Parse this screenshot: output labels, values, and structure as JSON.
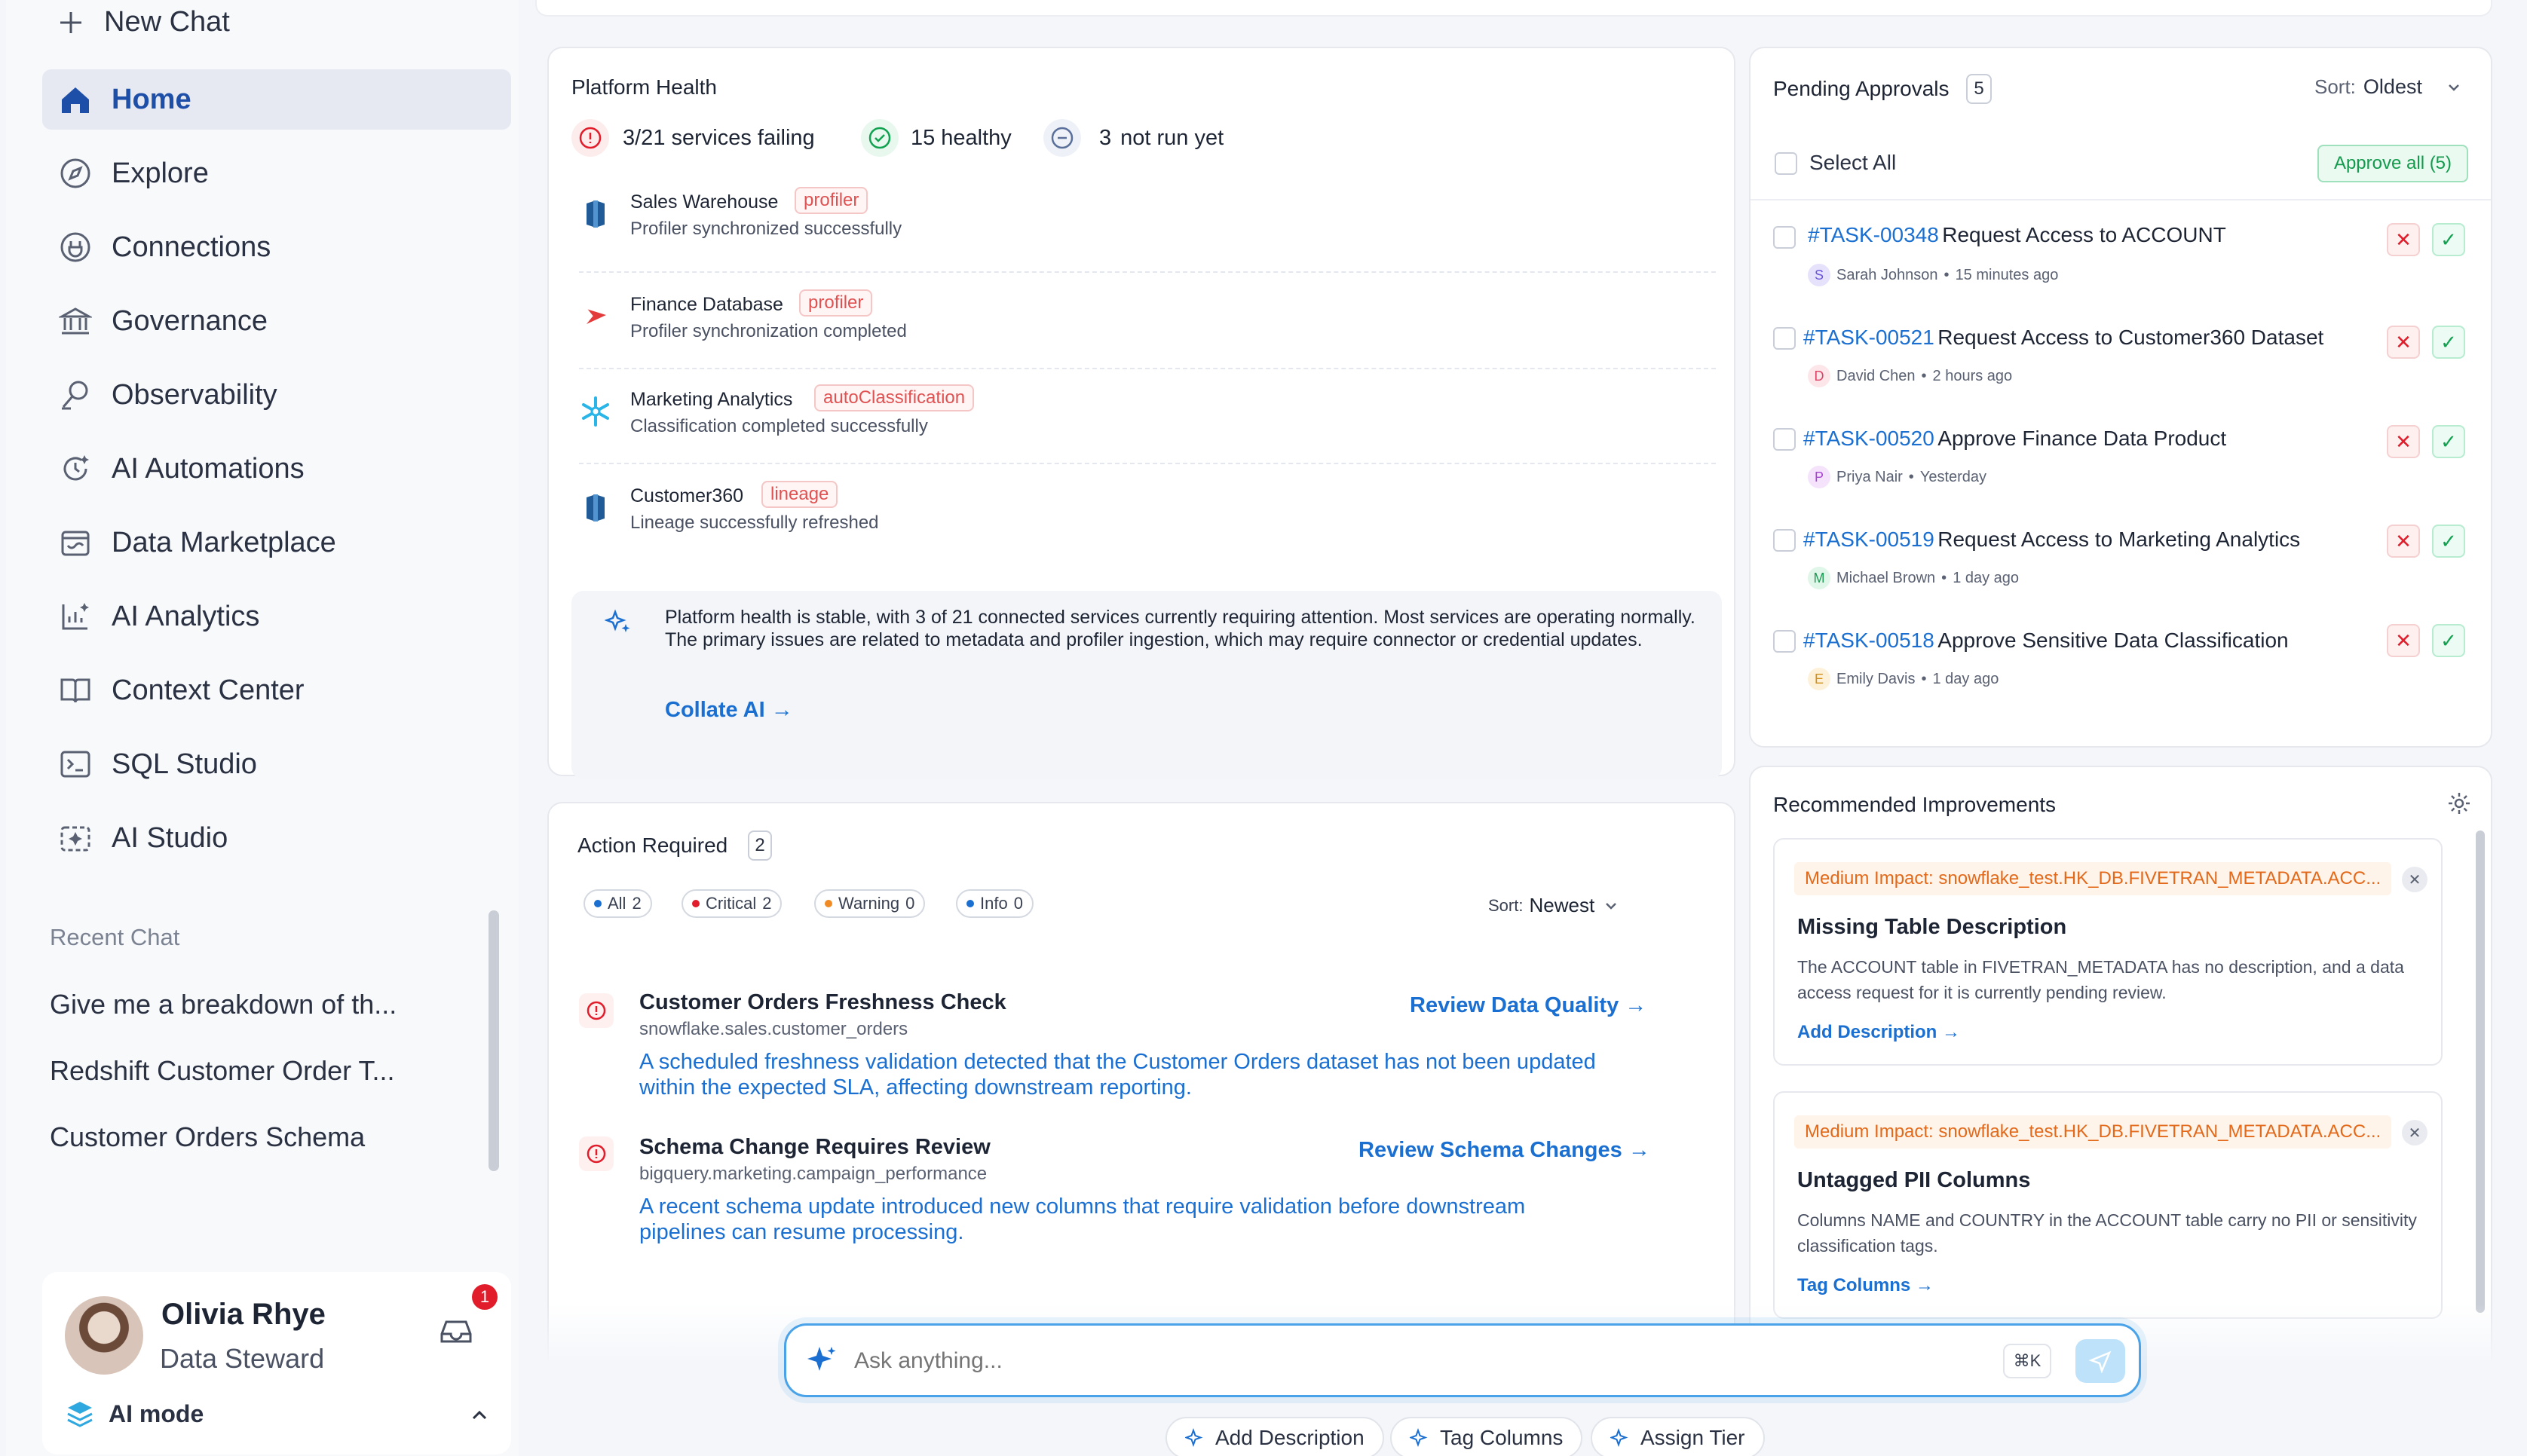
{
  "sidebar": {
    "new_chat": "New Chat",
    "items": [
      {
        "label": "Home",
        "icon": "home-icon"
      },
      {
        "label": "Explore",
        "icon": "compass-icon"
      },
      {
        "label": "Connections",
        "icon": "plug-icon"
      },
      {
        "label": "Governance",
        "icon": "bank-icon"
      },
      {
        "label": "Observability",
        "icon": "telescope-icon"
      },
      {
        "label": "AI Automations",
        "icon": "automation-icon"
      },
      {
        "label": "Data Marketplace",
        "icon": "store-icon"
      },
      {
        "label": "AI Analytics",
        "icon": "analytics-icon"
      },
      {
        "label": "Context Center",
        "icon": "book-icon"
      },
      {
        "label": "SQL Studio",
        "icon": "terminal-icon"
      },
      {
        "label": "AI Studio",
        "icon": "sparkle-box-icon"
      }
    ],
    "recent_title": "Recent Chat",
    "recent": [
      "Give me a breakdown of th...",
      "Redshift Customer Order T...",
      "Customer Orders Schema"
    ],
    "user": {
      "name": "Olivia Rhye",
      "role": "Data Steward",
      "notifications": "1",
      "mode": "AI mode"
    }
  },
  "health": {
    "title": "Platform Health",
    "failing": "3/21 services failing",
    "healthy_count": "15",
    "healthy_label": "healthy",
    "notrun_count": "3",
    "notrun_label": "not run yet",
    "services": [
      {
        "name": "Sales Warehouse",
        "tag": "profiler",
        "desc": "Profiler synchronized successfully",
        "icon": "redshift-icon"
      },
      {
        "name": "Finance Database",
        "tag": "profiler",
        "desc": "Profiler synchronization completed",
        "icon": "database-icon"
      },
      {
        "name": "Marketing Analytics",
        "tag": "autoClassification",
        "desc": "Classification completed successfully",
        "icon": "snowflake-icon"
      },
      {
        "name": "Customer360",
        "tag": "lineage",
        "desc": "Lineage successfully refreshed",
        "icon": "redshift-icon"
      }
    ],
    "summary": "Platform health is stable, with 3 of 21 connected services currently requiring attention. Most services are operating normally. The primary issues are related to metadata and profiler ingestion, which may require connector or credential updates.",
    "collate_link": "Collate AI →"
  },
  "actions": {
    "title": "Action Required",
    "count": "2",
    "filters": [
      {
        "label": "All",
        "count": "2",
        "color": "#1a6fd1"
      },
      {
        "label": "Critical",
        "count": "2",
        "color": "#e11d2b"
      },
      {
        "label": "Warning",
        "count": "0",
        "color": "#f08a24"
      },
      {
        "label": "Info",
        "count": "0",
        "color": "#1a6fd1"
      }
    ],
    "sort_label": "Sort:",
    "sort_value": "Newest",
    "items": [
      {
        "title": "Customer Orders Freshness Check",
        "source": "snowflake.sales.customer_orders",
        "desc_line1": "A scheduled freshness validation detected that the Customer Orders dataset has not been updated",
        "desc_line2": "within the expected SLA, affecting downstream reporting.",
        "link": "Review Data Quality →"
      },
      {
        "title": "Schema Change Requires Review",
        "source": "bigquery.marketing.campaign_performance",
        "desc_line1": "A recent schema update introduced new columns that require validation before downstream",
        "desc_line2": "pipelines can resume processing.",
        "link": "Review Schema Changes →"
      }
    ]
  },
  "approvals": {
    "title": "Pending Approvals",
    "count": "5",
    "sort_label": "Sort:",
    "sort_value": "Oldest",
    "select_all": "Select All",
    "approve_all": "Approve all (5)",
    "items": [
      {
        "id": "#TASK-00348",
        "title": "Request Access to ACCOUNT",
        "initial": "S",
        "user": "Sarah Johnson",
        "time": "15 minutes ago",
        "av_bg": "#e6e2fb",
        "av_fg": "#6a55d9"
      },
      {
        "id": "#TASK-00521",
        "title": "Request Access to Customer360 Dataset",
        "initial": "D",
        "user": "David Chen",
        "time": "2 hours ago",
        "av_bg": "#fde6ea",
        "av_fg": "#d94467"
      },
      {
        "id": "#TASK-00520",
        "title": "Approve Finance Data Product",
        "initial": "P",
        "user": "Priya Nair",
        "time": "Yesterday",
        "av_bg": "#f4e3fb",
        "av_fg": "#a745d0"
      },
      {
        "id": "#TASK-00519",
        "title": "Request Access to Marketing Analytics",
        "initial": "M",
        "user": "Michael Brown",
        "time": "1 day ago",
        "av_bg": "#dff6e8",
        "av_fg": "#1f9a55"
      },
      {
        "id": "#TASK-00518",
        "title": "Approve Sensitive Data Classification",
        "initial": "E",
        "user": "Emily Davis",
        "time": "1 day ago",
        "av_bg": "#fdf1d9",
        "av_fg": "#d39019"
      }
    ]
  },
  "recommendations": {
    "title": "Recommended Improvements",
    "items": [
      {
        "impact": "Medium Impact: snowflake_test.HK_DB.FIVETRAN_METADATA.ACC...",
        "title": "Missing Table Description",
        "desc": "The ACCOUNT table in FIVETRAN_METADATA has no description, and a data access request for it is currently pending review.",
        "link": "Add Description →"
      },
      {
        "impact": "Medium Impact: snowflake_test.HK_DB.FIVETRAN_METADATA.ACC...",
        "title": "Untagged PII Columns",
        "desc": "Columns NAME and COUNTRY in the ACCOUNT table carry no PII or sensitivity classification tags.",
        "link": "Tag Columns →"
      }
    ]
  },
  "ask": {
    "placeholder": "Ask anything...",
    "shortcut": "⌘K",
    "quick": [
      "Add Description",
      "Tag Columns",
      "Assign Tier"
    ]
  },
  "colors": {
    "accent": "#1a6fd1",
    "danger": "#e11d2b",
    "success": "#12a150",
    "warning": "#e3691a"
  }
}
